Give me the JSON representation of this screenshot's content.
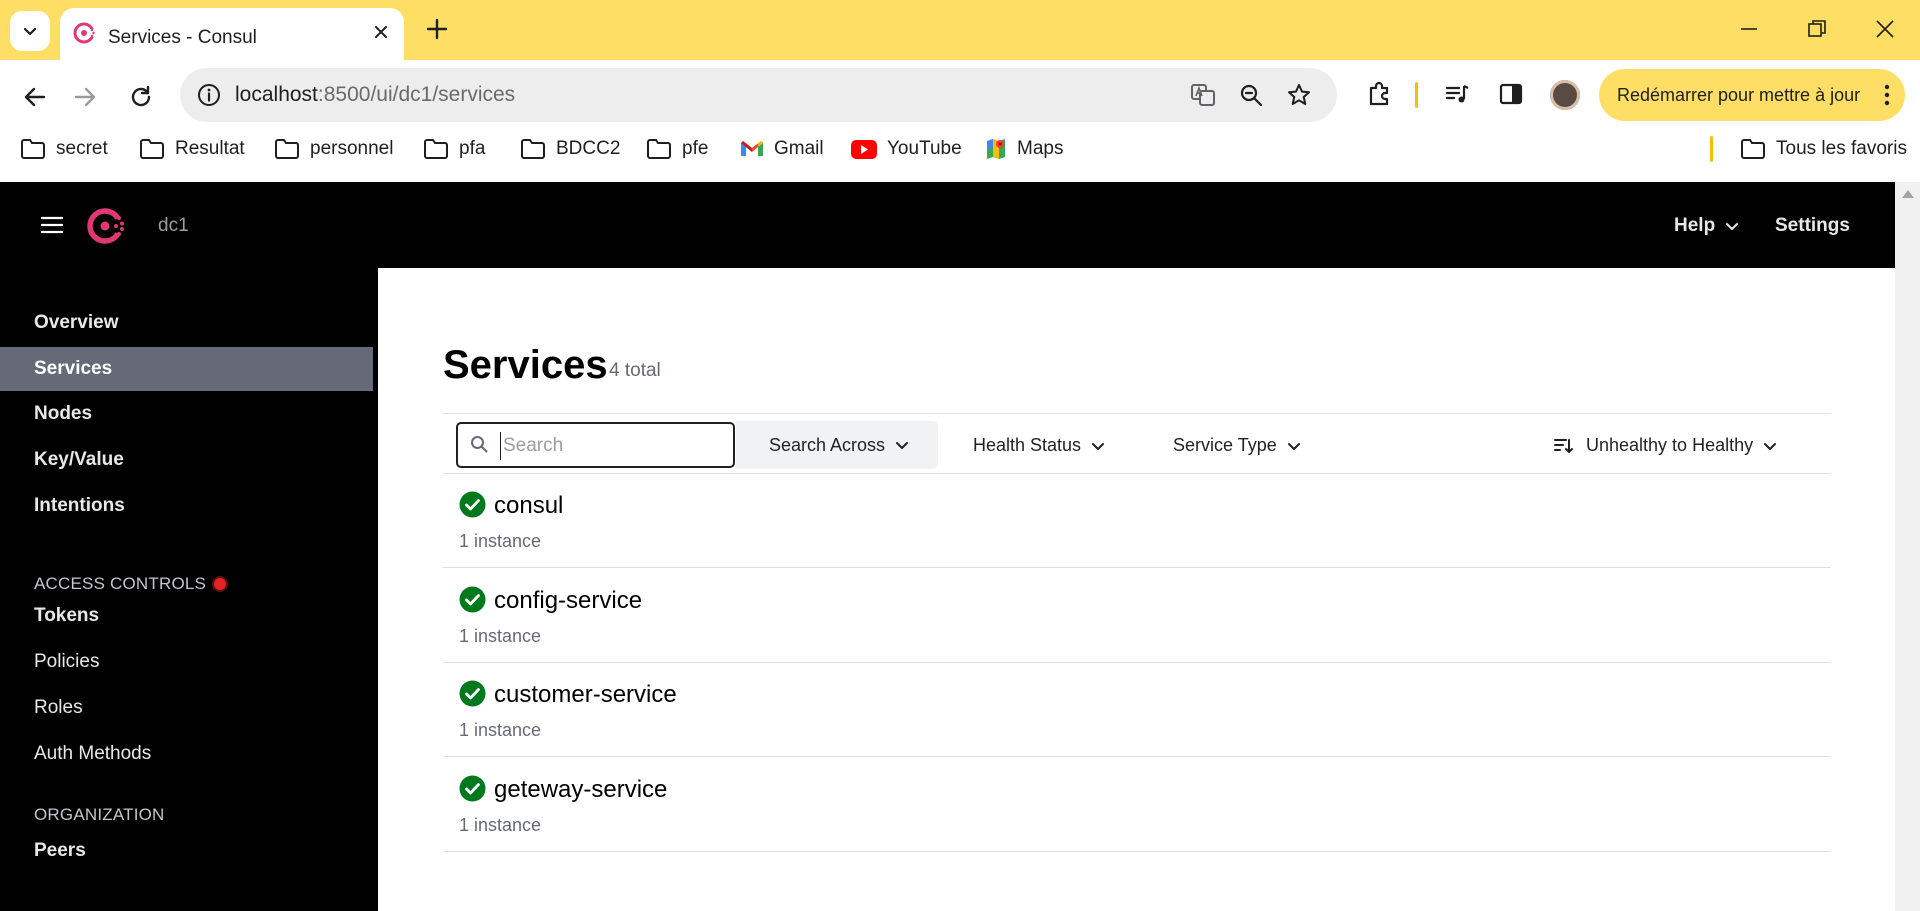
{
  "browser": {
    "tab_title": "Services - Consul",
    "url_host": "localhost",
    "url_rest": ":8500/ui/dc1/services",
    "restart_label": "Redémarrer pour mettre à jour",
    "bookmarks": [
      {
        "label": "secret",
        "icon": "folder-icon"
      },
      {
        "label": "Resultat",
        "icon": "folder-icon"
      },
      {
        "label": "personnel",
        "icon": "folder-icon"
      },
      {
        "label": "pfa",
        "icon": "folder-icon"
      },
      {
        "label": "BDCC2",
        "icon": "folder-icon"
      },
      {
        "label": "pfe",
        "icon": "folder-icon"
      },
      {
        "label": "Gmail",
        "icon": "gmail-icon"
      },
      {
        "label": "YouTube",
        "icon": "youtube-icon"
      },
      {
        "label": "Maps",
        "icon": "maps-icon"
      }
    ],
    "all_bookmarks_label": "Tous les favoris"
  },
  "header": {
    "datacenter": "dc1",
    "help_label": "Help",
    "settings_label": "Settings"
  },
  "sidebar": {
    "items": [
      {
        "label": "Overview",
        "active": false
      },
      {
        "label": "Services",
        "active": true
      },
      {
        "label": "Nodes",
        "active": false
      },
      {
        "label": "Key/Value",
        "active": false
      },
      {
        "label": "Intentions",
        "active": false
      }
    ],
    "access_controls_title": "ACCESS CONTROLS",
    "access_controls": [
      {
        "label": "Tokens"
      },
      {
        "label": "Policies"
      },
      {
        "label": "Roles"
      },
      {
        "label": "Auth Methods"
      }
    ],
    "organization_title": "ORGANIZATION",
    "organization": [
      {
        "label": "Peers"
      }
    ]
  },
  "main": {
    "title": "Services",
    "count": "4 total",
    "search_placeholder": "Search",
    "search_value": "",
    "search_across_label": "Search Across",
    "health_status_label": "Health Status",
    "service_type_label": "Service Type",
    "sort_label": "Unhealthy to Healthy",
    "services": [
      {
        "name": "consul",
        "instances": "1 instance",
        "status": "passing"
      },
      {
        "name": "config-service",
        "instances": "1 instance",
        "status": "passing"
      },
      {
        "name": "customer-service",
        "instances": "1 instance",
        "status": "passing"
      },
      {
        "name": "geteway-service",
        "instances": "1 instance",
        "status": "passing"
      }
    ]
  },
  "colors": {
    "tabbar": "#ffde66",
    "consul_brand": "#e03875",
    "sidebar_active": "#656a76",
    "passing": "#00781e",
    "alert_dot": "#e52228"
  }
}
